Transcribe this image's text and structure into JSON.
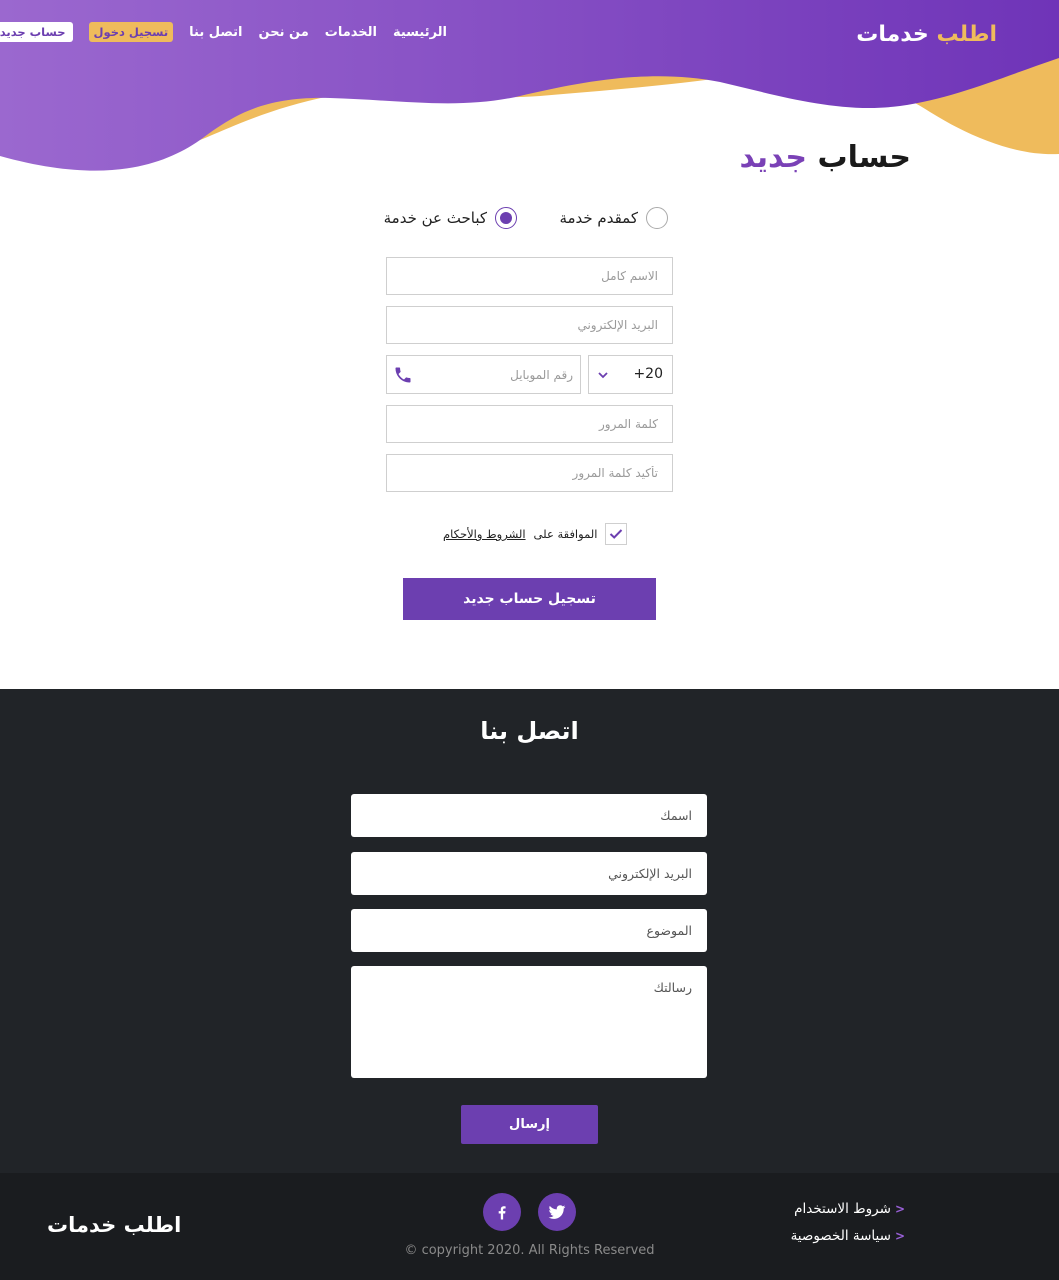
{
  "header": {
    "brand_first": "اطلب",
    "brand_second": "خدمات",
    "nav": [
      "الرئيسية",
      "الخدمات",
      "من نحن",
      "اتصل بنا"
    ],
    "login_label": "تسجيل دخول",
    "register_label": "حساب جديد"
  },
  "register": {
    "title_first": "حساب",
    "title_second": "جديد",
    "role_provider": "كمقدم خدمة",
    "role_seeker": "كباحث عن خدمة",
    "selected_role": "كباحث عن خدمة",
    "fullname_placeholder": "الاسم كامل",
    "email_placeholder": "البريد الإلكتروني",
    "country_code": "+20",
    "mobile_placeholder": "رقم الموبايل",
    "password_placeholder": "كلمة المرور",
    "confirm_placeholder": "تأكيد كلمة المرور",
    "terms_prefix": "الموافقة على",
    "terms_link": "الشروط والأحكام",
    "terms_checked": true,
    "submit_label": "تسجيل حساب جديد"
  },
  "contact": {
    "title": "اتصل بنا",
    "name_placeholder": "اسمك",
    "email_placeholder": "البريد الإلكتروني",
    "subject_placeholder": "الموضوع",
    "message_placeholder": "رسالتك",
    "send_label": "إرسال"
  },
  "footer": {
    "brand": "اطلب خدمات",
    "copyright": "© copyright 2020. All Rights Reserved",
    "links": [
      "شروط الاستخدام",
      "سياسة الخصوصية"
    ],
    "social_icons": [
      "twitter-icon",
      "facebook-icon"
    ]
  },
  "colors": {
    "primary": "#6c3fb0",
    "accent": "#efbb5c",
    "dark": "#212428",
    "footer": "#1a1c1f"
  }
}
